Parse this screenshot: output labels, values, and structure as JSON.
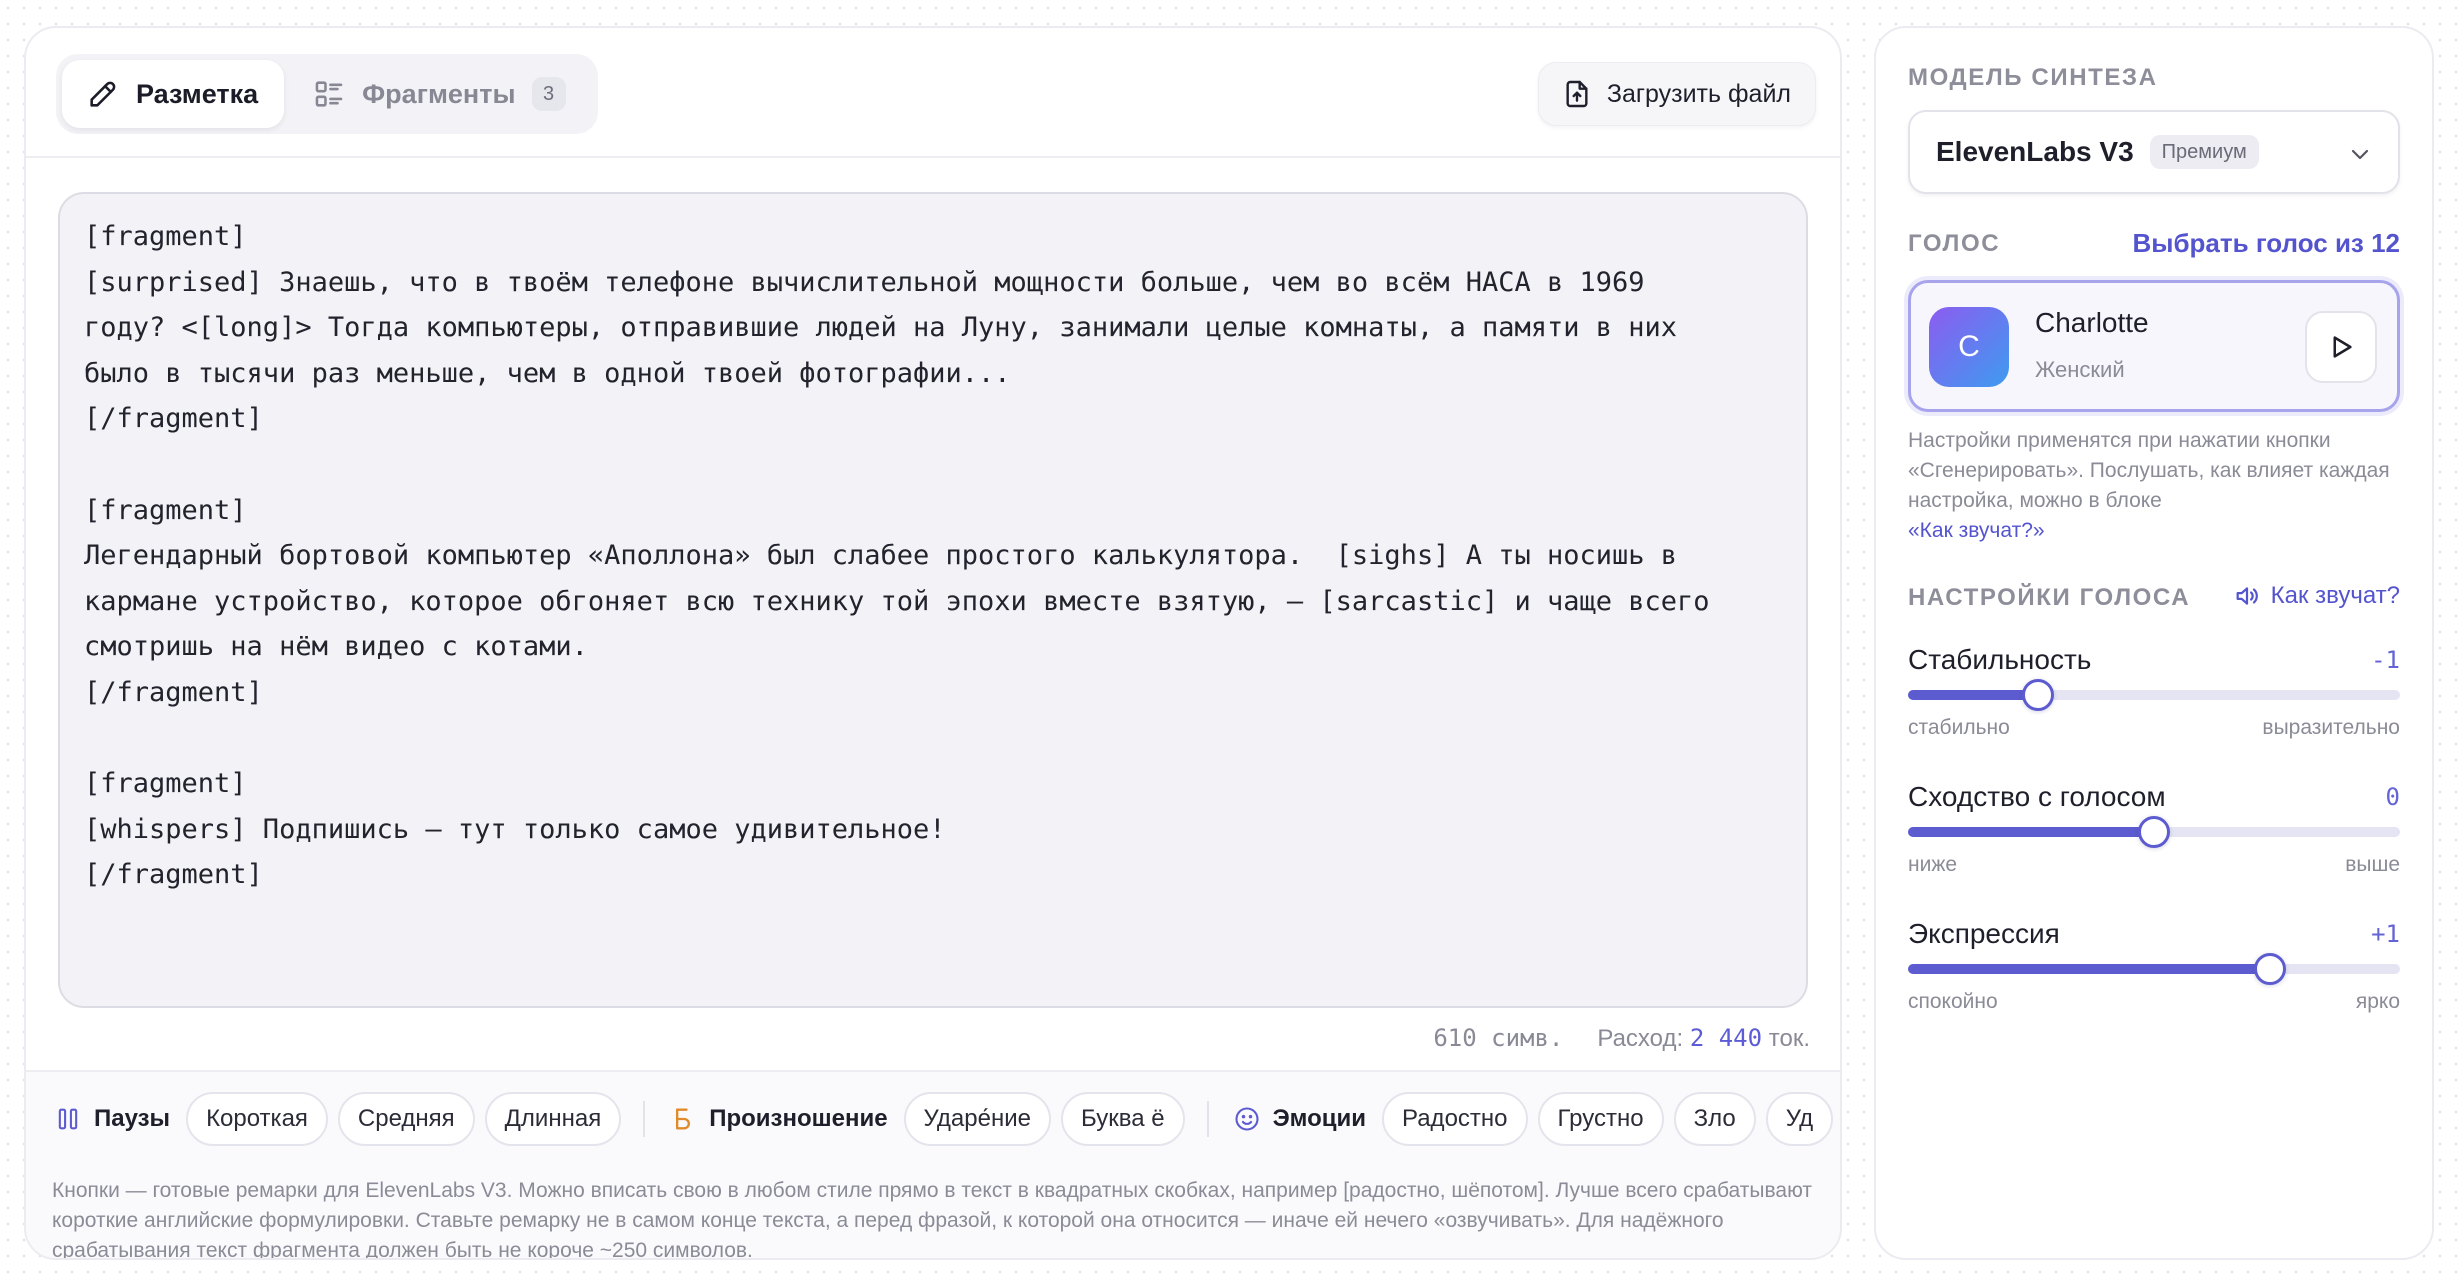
{
  "editor": {
    "tabs": [
      {
        "label": "Разметка",
        "icon": "pencil-icon",
        "active": true
      },
      {
        "label": "Фрагменты",
        "icon": "list-icon",
        "badge": "3",
        "active": false
      }
    ],
    "upload_label": "Загрузить файл",
    "text": "[fragment]\n[surprised] Знаешь, что в твоём телефоне вычислительной мощности больше, чем во всём НАСА в 1969\nгоду? <[long]> Тогда компьютеры, отправившие людей на Луну, занимали целые комнаты, а памяти в них\nбыло в тысячи раз меньше, чем в одной твоей фотографии...\n[/fragment]\n\n[fragment]\nЛегендарный бортовой компьютер «Аполлона» был слабее простого калькулятора.  [sighs] А ты носишь в\nкармане устройство, которое обгоняет всю технику той эпохи вместе взятую, — [sarcastic] и чаще всего\nсмотришь на нём видео с котами.\n[/fragment]\n\n[fragment]\n[whispers] Подпишись — тут только самое удивительное!\n[/fragment]",
    "char_count": "610 симв.",
    "cost_label": "Расход:",
    "cost_value": "2 440",
    "cost_unit": "ток.",
    "groups": {
      "pauses": {
        "label": "Паузы",
        "icon": "pause-icon",
        "chips": [
          "Короткая",
          "Средняя",
          "Длинная"
        ]
      },
      "pronunciation": {
        "label": "Произношение",
        "icon": "letter-b-icon",
        "chips": [
          "Ударе́ние",
          "Буква ё"
        ]
      },
      "emotions": {
        "label": "Эмоции",
        "icon": "smile-icon",
        "chips": [
          "Радостно",
          "Грустно",
          "Зло",
          "Уд"
        ]
      }
    },
    "hint": "Кнопки — готовые ремарки для ElevenLabs V3. Можно вписать свою в любом стиле прямо в текст в квадратных скобках, например [радостно, шёпотом]. Лучше всего срабатывают короткие английские формулировки. Ставьте ремарку не в самом конце текста, а перед фразой, к которой она относится — иначе ей нечего «озвучивать». Для надёжного срабатывания текст фрагмента должен быть не короче ~250 символов."
  },
  "settings": {
    "model_title": "Модель синтеза",
    "model_name": "ElevenLabs V3",
    "model_badge": "Премиум",
    "voice_title": "Голос",
    "voice_link": "Выбрать голос из 12",
    "voice": {
      "initial": "C",
      "name": "Charlotte",
      "gender": "Женский"
    },
    "note": "Настройки применятся при нажатии кнопки «Сгенерировать». Послушать, как влияет каждая настройка, можно в блоке ",
    "note_link": "«Как звучат?»",
    "voice_settings_title": "Настройки голоса",
    "how_sounds_label": "Как звучат?",
    "sliders": [
      {
        "name": "Стабильность",
        "value": "-1",
        "position": 0.265,
        "min_label": "стабильно",
        "max_label": "выразительно"
      },
      {
        "name": "Сходство с голосом",
        "value": "0",
        "position": 0.5,
        "min_label": "ниже",
        "max_label": "выше"
      },
      {
        "name": "Экспрессия",
        "value": "+1",
        "position": 0.735,
        "min_label": "спокойно",
        "max_label": "ярко"
      }
    ]
  },
  "colors": {
    "accent": "#5c5cd0",
    "link": "#5454cf",
    "pronunciation_icon": "#e08a2c"
  }
}
